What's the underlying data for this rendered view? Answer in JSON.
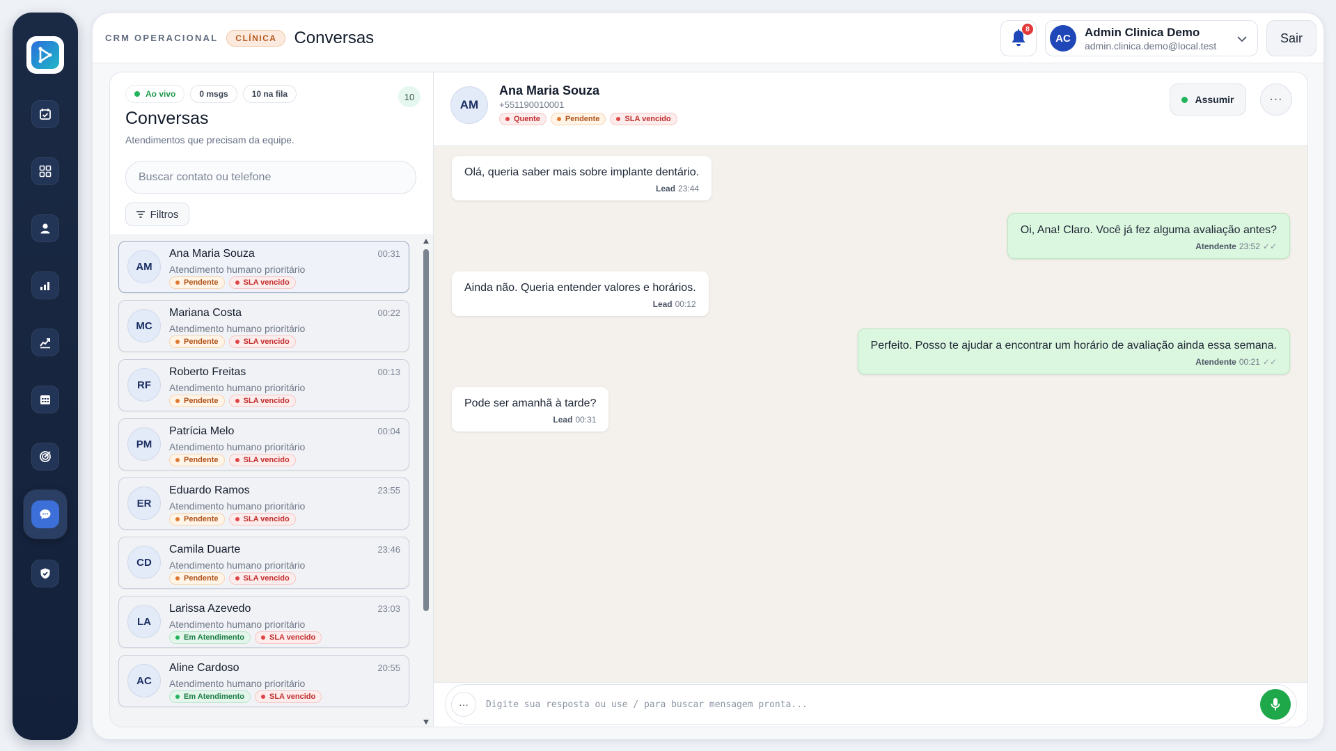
{
  "header": {
    "breadcrumb": "CRM OPERACIONAL",
    "badge": "CLÍNICA",
    "title": "Conversas",
    "notification_count": "8",
    "user": {
      "initials": "AC",
      "name": "Admin Clinica Demo",
      "email": "admin.clinica.demo@local.test"
    },
    "logout_label": "Sair"
  },
  "sidebar": {
    "items": [
      {
        "icon": "calendar-check-icon"
      },
      {
        "icon": "dashboard-icon"
      },
      {
        "icon": "user-icon"
      },
      {
        "icon": "bar-chart-icon"
      },
      {
        "icon": "trend-chart-icon"
      },
      {
        "icon": "calendar-grid-icon"
      },
      {
        "icon": "target-icon"
      },
      {
        "icon": "chat-bubble-icon",
        "active": true
      },
      {
        "icon": "shield-icon"
      }
    ]
  },
  "list": {
    "live_label": "Ao vivo",
    "msgs_chip": "0 msgs",
    "queue_chip": "10 na fila",
    "count": "10",
    "title": "Conversas",
    "subtitle": "Atendimentos que precisam da equipe.",
    "search_placeholder": "Buscar contato ou telefone",
    "filters_label": "Filtros",
    "conversations": [
      {
        "initials": "AM",
        "name": "Ana Maria Souza",
        "time": "00:31",
        "subtitle": "Atendimento humano prioritário",
        "status": "Pendente",
        "sla": "SLA vencido"
      },
      {
        "initials": "MC",
        "name": "Mariana Costa",
        "time": "00:22",
        "subtitle": "Atendimento humano prioritário",
        "status": "Pendente",
        "sla": "SLA vencido"
      },
      {
        "initials": "RF",
        "name": "Roberto Freitas",
        "time": "00:13",
        "subtitle": "Atendimento humano prioritário",
        "status": "Pendente",
        "sla": "SLA vencido"
      },
      {
        "initials": "PM",
        "name": "Patrícia Melo",
        "time": "00:04",
        "subtitle": "Atendimento humano prioritário",
        "status": "Pendente",
        "sla": "SLA vencido"
      },
      {
        "initials": "ER",
        "name": "Eduardo Ramos",
        "time": "23:55",
        "subtitle": "Atendimento humano prioritário",
        "status": "Pendente",
        "sla": "SLA vencido"
      },
      {
        "initials": "CD",
        "name": "Camila Duarte",
        "time": "23:46",
        "subtitle": "Atendimento humano prioritário",
        "status": "Pendente",
        "sla": "SLA vencido"
      },
      {
        "initials": "LA",
        "name": "Larissa Azevedo",
        "time": "23:03",
        "subtitle": "Atendimento humano prioritário",
        "status": "Em Atendimento",
        "sla": "SLA vencido"
      },
      {
        "initials": "AC",
        "name": "Aline Cardoso",
        "time": "20:55",
        "subtitle": "Atendimento humano prioritário",
        "status": "Em Atendimento",
        "sla": "SLA vencido"
      }
    ]
  },
  "chat": {
    "initials": "AM",
    "name": "Ana Maria Souza",
    "phone": "+551190010001",
    "tags": [
      "Quente",
      "Pendente",
      "SLA vencido"
    ],
    "assume_label": "Assumir",
    "more_label": "···",
    "messages": [
      {
        "direction": "in",
        "text": "Olá, queria saber mais sobre implante dentário.",
        "author": "Lead",
        "time": "23:44"
      },
      {
        "direction": "out",
        "text": "Oi, Ana! Claro. Você já fez alguma avaliação antes?",
        "author": "Atendente",
        "time": "23:52",
        "check": "✓✓"
      },
      {
        "direction": "in",
        "text": "Ainda não. Queria entender valores e horários.",
        "author": "Lead",
        "time": "00:12"
      },
      {
        "direction": "out",
        "text": "Perfeito. Posso te ajudar a encontrar um horário de avaliação ainda essa semana.",
        "author": "Atendente",
        "time": "00:21",
        "check": "✓✓"
      },
      {
        "direction": "in",
        "text": "Pode ser amanhã à tarde?",
        "author": "Lead",
        "time": "00:31"
      }
    ],
    "composer_placeholder": "Digite sua resposta ou use / para buscar mensagem pronta...",
    "composer_more": "···"
  }
}
